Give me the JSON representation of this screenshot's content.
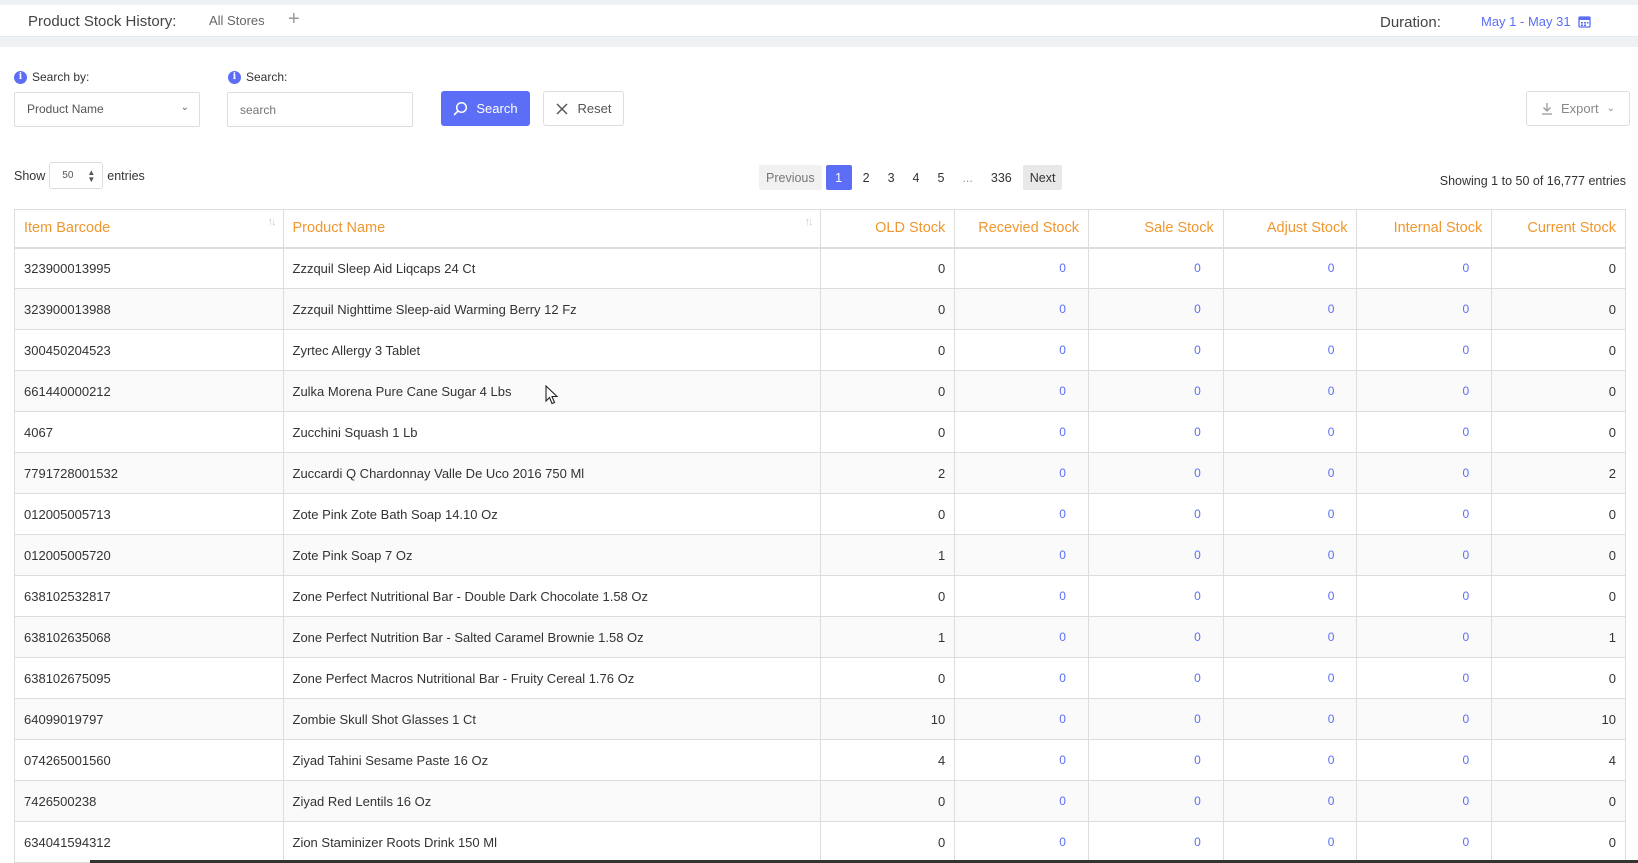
{
  "header": {
    "title": "Product Stock History:",
    "store": "All Stores",
    "plus": "+",
    "duration_label": "Duration:",
    "duration_value": "May 1 - May 31"
  },
  "filters": {
    "search_by_label": "Search by:",
    "search_by_value": "Product Name",
    "search_label": "Search:",
    "search_placeholder": "search",
    "search_button": "Search",
    "reset_button": "Reset",
    "export_button": "Export"
  },
  "pagination": {
    "show_label": "Show",
    "page_size": "50",
    "entries_label": "entries",
    "previous": "Previous",
    "pages": [
      "1",
      "2",
      "3",
      "4",
      "5"
    ],
    "dots": "...",
    "last_page": "336",
    "next": "Next",
    "showing_text": "Showing 1 to 50 of 16,777 entries"
  },
  "table": {
    "columns": [
      "Item Barcode",
      "Product Name",
      "OLD Stock",
      "Recevied Stock",
      "Sale Stock",
      "Adjust Stock",
      "Internal Stock",
      "Current Stock"
    ],
    "rows": [
      [
        "323900013995",
        "Zzzquil Sleep Aid Liqcaps 24 Ct",
        "0",
        "0",
        "0",
        "0",
        "0",
        "0"
      ],
      [
        "323900013988",
        "Zzzquil Nighttime Sleep-aid Warming Berry 12 Fz",
        "0",
        "0",
        "0",
        "0",
        "0",
        "0"
      ],
      [
        "300450204523",
        "Zyrtec Allergy 3 Tablet",
        "0",
        "0",
        "0",
        "0",
        "0",
        "0"
      ],
      [
        "661440000212",
        "Zulka Morena Pure Cane Sugar 4 Lbs",
        "0",
        "0",
        "0",
        "0",
        "0",
        "0"
      ],
      [
        "4067",
        "Zucchini Squash 1 Lb",
        "0",
        "0",
        "0",
        "0",
        "0",
        "0"
      ],
      [
        "7791728001532",
        "Zuccardi Q Chardonnay Valle De Uco 2016 750 Ml",
        "2",
        "0",
        "0",
        "0",
        "0",
        "2"
      ],
      [
        "012005005713",
        "Zote Pink Zote Bath Soap 14.10 Oz",
        "0",
        "0",
        "0",
        "0",
        "0",
        "0"
      ],
      [
        "012005005720",
        "Zote Pink Soap 7 Oz",
        "1",
        "0",
        "0",
        "0",
        "0",
        "0"
      ],
      [
        "638102532817",
        "Zone Perfect Nutritional Bar - Double Dark Chocolate 1.58 Oz",
        "0",
        "0",
        "0",
        "0",
        "0",
        "0"
      ],
      [
        "638102635068",
        "Zone Perfect Nutrition Bar - Salted Caramel Brownie 1.58 Oz",
        "1",
        "0",
        "0",
        "0",
        "0",
        "1"
      ],
      [
        "638102675095",
        "Zone Perfect Macros Nutritional Bar - Fruity Cereal 1.76 Oz",
        "0",
        "0",
        "0",
        "0",
        "0",
        "0"
      ],
      [
        "64099019797",
        "Zombie Skull Shot Glasses 1 Ct",
        "10",
        "0",
        "0",
        "0",
        "0",
        "10"
      ],
      [
        "074265001560",
        "Ziyad Tahini Sesame Paste 16 Oz",
        "4",
        "0",
        "0",
        "0",
        "0",
        "4"
      ],
      [
        "7426500238",
        "Ziyad Red Lentils 16 Oz",
        "0",
        "0",
        "0",
        "0",
        "0",
        "0"
      ],
      [
        "634041594312",
        "Zion Staminizer Roots Drink 150 Ml",
        "0",
        "0",
        "0",
        "0",
        "0",
        "0"
      ]
    ]
  },
  "colors": {
    "accent": "#5b6ef5",
    "header_text": "#f0972f"
  }
}
